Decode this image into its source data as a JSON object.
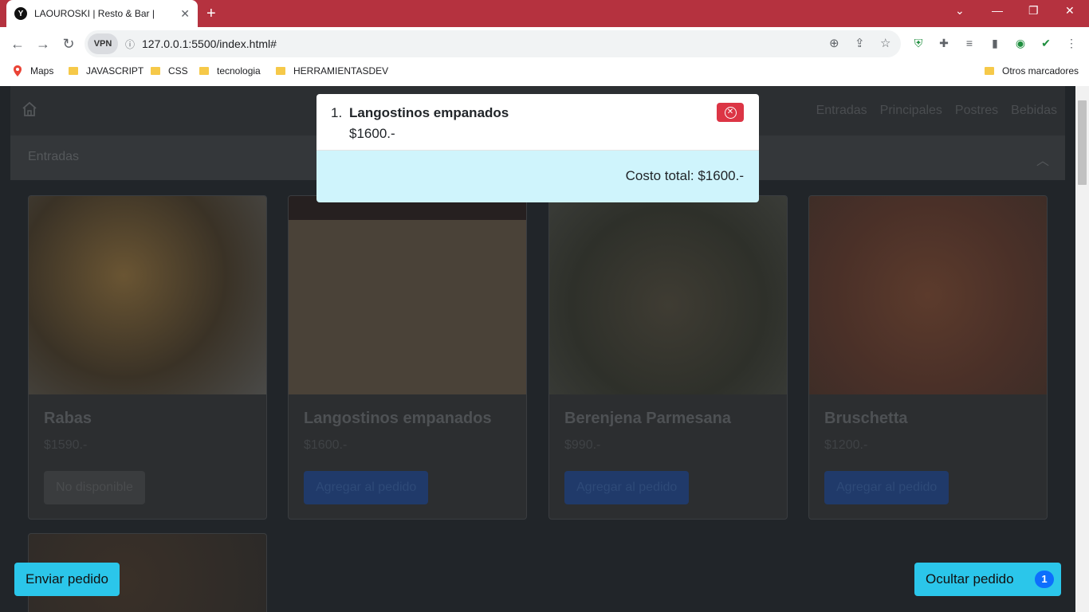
{
  "browser": {
    "tab_title": "LAOUROSKI | Resto & Bar |",
    "tab_favicon": "Y",
    "tab_close": "✕",
    "new_tab": "+",
    "url": "127.0.0.1:5500/index.html#",
    "vpn_label": "VPN",
    "bookmarks": [
      "Maps",
      "JAVASCRIPT",
      "CSS",
      "tecnologia",
      "HERRAMIENTASDEV"
    ],
    "other_bookmarks": "Otros marcadores"
  },
  "navbar": {
    "links": [
      "Entradas",
      "Principales",
      "Postres",
      "Bebidas"
    ]
  },
  "accordion": {
    "label": "Entradas"
  },
  "cards": [
    {
      "name": "Rabas",
      "price": "$1590.-",
      "button": "No disponible"
    },
    {
      "name": "Langostinos empanados",
      "price": "$1600.-",
      "button": "Agregar al pedido"
    },
    {
      "name": "Berenjena Parmesana",
      "price": "$990.-",
      "button": "Agregar al pedido"
    },
    {
      "name": "Bruschetta",
      "price": "$1200.-",
      "button": "Agregar al pedido"
    }
  ],
  "order": {
    "items": [
      {
        "num": "1.",
        "name": "Langostinos empanados",
        "price": "$1600.-"
      }
    ],
    "total": "Costo total: $1600.-"
  },
  "actions": {
    "send": "Enviar pedido",
    "hide": "Ocultar pedido",
    "count": "1"
  },
  "colors": {
    "titlebar": "#b5323f",
    "total_bg": "#cff4fc",
    "action_btn": "#2bc6ea",
    "badge": "#0d6efd",
    "remove_btn": "#dc3545"
  }
}
